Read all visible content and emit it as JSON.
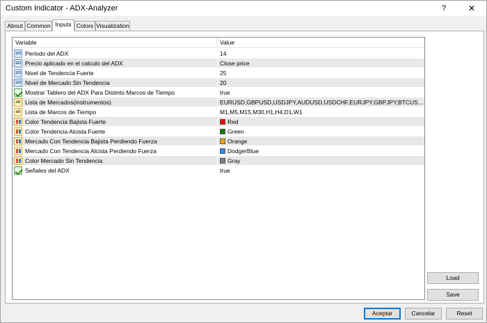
{
  "window": {
    "title": "Custom Indicator - ADX-Analyzer",
    "help_label": "?",
    "close_label": "✕"
  },
  "tabs": [
    {
      "label": "About",
      "active": false
    },
    {
      "label": "Common",
      "active": false
    },
    {
      "label": "Inputs",
      "active": true
    },
    {
      "label": "Colors",
      "active": false
    },
    {
      "label": "Visualization",
      "active": false
    }
  ],
  "grid": {
    "columns": {
      "variable": "Variable",
      "value": "Value"
    },
    "rows": [
      {
        "type": "int",
        "icon": "int-param-icon",
        "icon_text": "123",
        "name": "Periodo del ADX",
        "value": "14"
      },
      {
        "type": "int",
        "icon": "int-param-icon",
        "icon_text": "123",
        "name": "Precio aplicado en el calculo del ADX",
        "value": "Close price"
      },
      {
        "type": "int",
        "icon": "int-param-icon",
        "icon_text": "123",
        "name": "Nivel de Tendencia Fuerte",
        "value": "25"
      },
      {
        "type": "int",
        "icon": "int-param-icon",
        "icon_text": "123",
        "name": "Nivel de Mercado Sin Tendencia",
        "value": "20"
      },
      {
        "type": "bool",
        "icon": "bool-param-icon",
        "icon_text": "",
        "name": "Mostrar Tablero del ADX Para Distinto Marcos de Tiempo",
        "value": "true"
      },
      {
        "type": "str",
        "icon": "string-param-icon",
        "icon_text": "ab",
        "name": "Lista de Mercados(instrumentos)",
        "value": "EURUSD,GBPUSD,USDJPY,AUDUSD,USDCHF,EURJPY,GBPJPY,BTCUSD,ETHUSD"
      },
      {
        "type": "str",
        "icon": "string-param-icon",
        "icon_text": "ab",
        "name": "Lista de Marcos de Tiempo",
        "value": "M1,M5,M15,M30,H1,H4,D1,W1"
      },
      {
        "type": "color",
        "icon": "color-param-icon",
        "icon_text": "",
        "name": "Color Tendencia Bajista Fuerte",
        "value": "Red",
        "swatch": "#ff0000"
      },
      {
        "type": "color",
        "icon": "color-param-icon",
        "icon_text": "",
        "name": "Color Tendencia Alcista Fuerte",
        "value": "Green",
        "swatch": "#008000"
      },
      {
        "type": "color",
        "icon": "color-param-icon",
        "icon_text": "",
        "name": "Mercado Con Tendencia Bajista Perdiendo Fuerza",
        "value": "Orange",
        "swatch": "#ffa500"
      },
      {
        "type": "color",
        "icon": "color-param-icon",
        "icon_text": "",
        "name": "Mercado Con Tendencia Alcista Perdiendo Fuerza",
        "value": "DodgerBlue",
        "swatch": "#1e90ff"
      },
      {
        "type": "color",
        "icon": "color-param-icon",
        "icon_text": "",
        "name": "Color Mercado Sin Tendencia",
        "value": "Gray",
        "swatch": "#808080"
      },
      {
        "type": "bool",
        "icon": "bool-param-icon",
        "icon_text": "",
        "name": "Señales del ADX",
        "value": "true"
      }
    ]
  },
  "side_buttons": {
    "load": "Load",
    "save": "Save"
  },
  "footer": {
    "accept": "Aceptar",
    "cancel": "Cancelar",
    "reset": "Reset"
  },
  "colors": {
    "accent": "#0078d7",
    "alt_row": "#e8e8e8"
  }
}
